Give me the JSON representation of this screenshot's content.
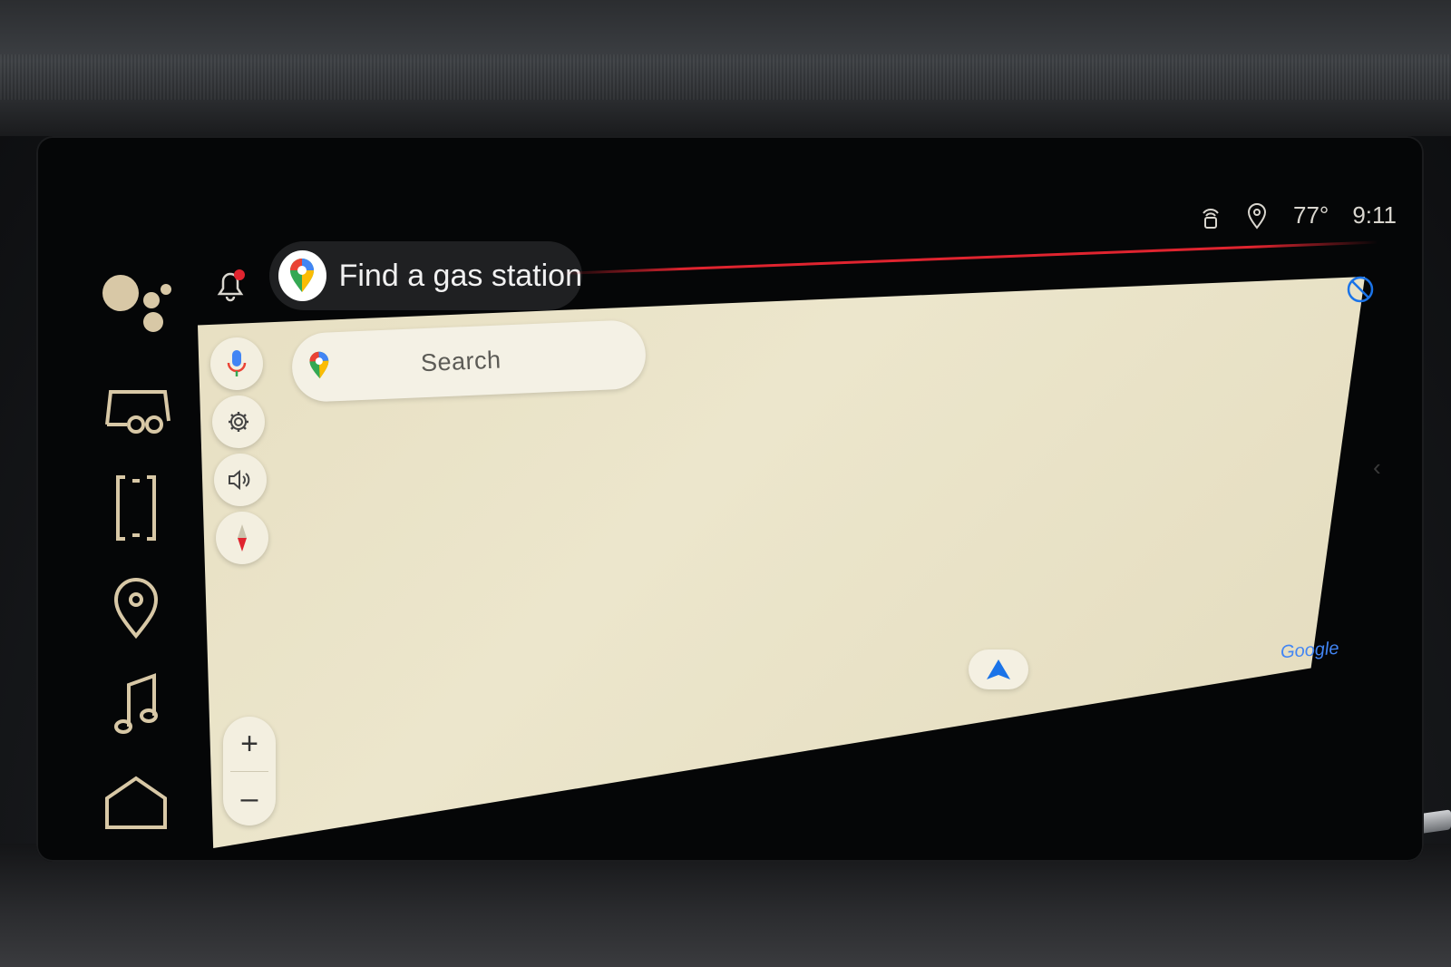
{
  "status_bar": {
    "temperature": "77°",
    "time": "9:11",
    "icons": [
      "connectivity-icon",
      "location-pin-icon"
    ]
  },
  "rail": {
    "items": [
      "assistant-icon",
      "vehicle-icon",
      "phone-icon",
      "navigation-pin-icon",
      "music-icon",
      "home-icon"
    ]
  },
  "assistant_suggestion": {
    "label": "Find a gas station",
    "icon": "google-maps-icon"
  },
  "map": {
    "search_placeholder": "Search",
    "controls": [
      "microphone-icon",
      "settings-gear-icon",
      "volume-icon",
      "compass-icon"
    ],
    "zoom_in_label": "+",
    "zoom_out_label": "–",
    "attribution": "Google",
    "colors": {
      "map_background": "#e9e2c6",
      "accent_red": "#e0242f",
      "nav_arrow_blue": "#1a73e8",
      "rail_gold": "#d8c8a6"
    }
  }
}
